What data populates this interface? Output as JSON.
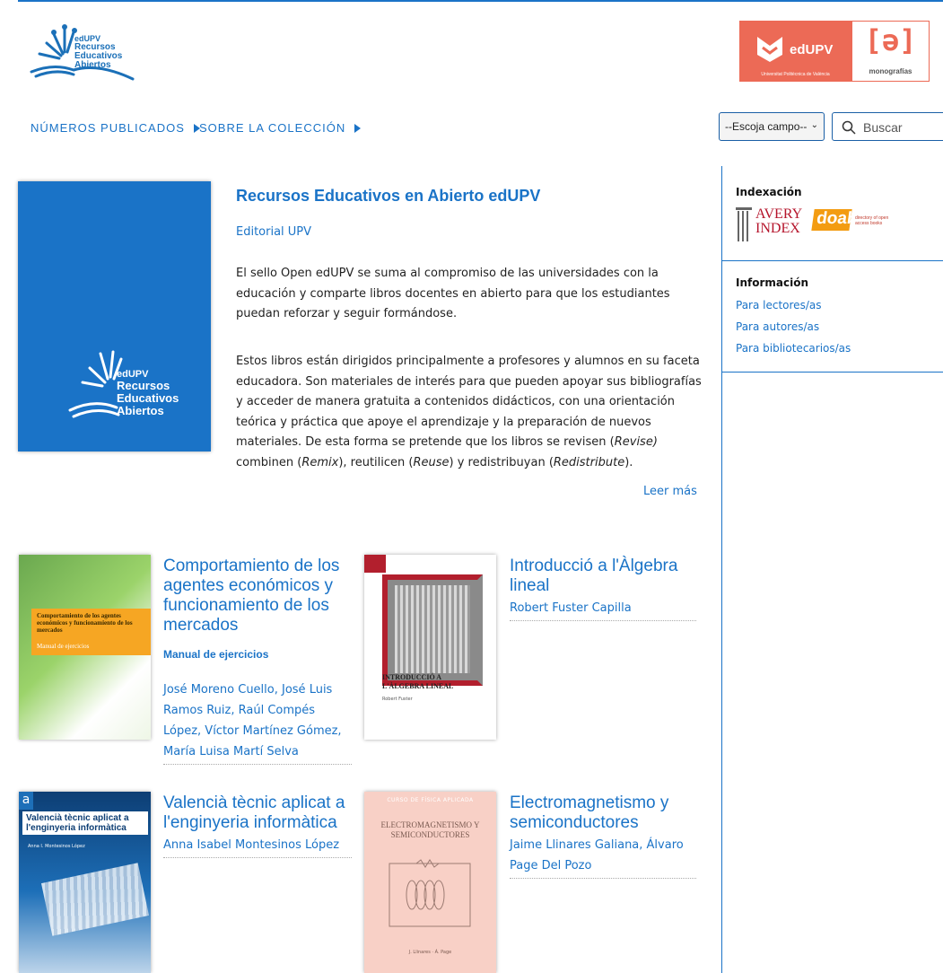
{
  "header": {
    "logo_text_1": "edUPV",
    "logo_text_2": "Recursos",
    "logo_text_3": "Educativos",
    "logo_text_4": "Abiertos",
    "edupv_brand": "edUPV",
    "edupv_sub": "Universitat Politècnica de València",
    "mono_glyph": "[ə]",
    "mono_label": "monografías"
  },
  "nav": {
    "item1": "NÚMEROS PUBLICADOS",
    "item2": "SOBRE LA COLECCIÓN",
    "select_value": "--Escoja campo--",
    "search_placeholder": "Buscar"
  },
  "sidebar": {
    "indexacion_title": "Indexación",
    "avery_1": "AVERY",
    "avery_2": "INDEX",
    "doab": "doab",
    "doab_sub": "directory of open access books",
    "informacion_title": "Información",
    "links": [
      "Para lectores/as",
      "Para autores/as",
      "Para bibliotecarios/as"
    ]
  },
  "featured": {
    "title": "Recursos Educativos en Abierto edUPV",
    "publisher": "Editorial UPV",
    "p1": "El sello Open edUPV se suma al compromiso de las universidades con la educación y comparte libros docentes en abierto para que los estudiantes puedan reforzar y seguir formándose.",
    "p2_a": "Estos libros están dirigidos principalmente a profesores y alumnos en su faceta educadora. Son materiales de interés para que pueden apoyar sus bibliografías y acceder de manera gratuita a contenidos didácticos, con una orientación teórica y práctica que apoye el aprendizaje y la preparación de nuevos materiales. De esta forma se pretende que los libros se revisen (",
    "revise": "Revise)",
    "p2_b": " combinen (",
    "remix": "Remix",
    "p2_c": "), reutilicen (",
    "reuse": "Reuse",
    "p2_d": ") y redistribuyan (",
    "redistribute": "Redistribute",
    "p2_e": ").",
    "read_more": "Leer más",
    "cover_1": "edUPV",
    "cover_2": "Recursos",
    "cover_3": "Educativos",
    "cover_4": "Abiertos"
  },
  "books": [
    {
      "title": "Comportamiento de los agentes económicos y funcionamiento de los mercados",
      "subtitle": "Manual de ejercicios",
      "authors": "José Moreno Cuello, José Luis Ramos Ruiz, Raúl Compés López, Víctor Martínez Gómez, María Luisa Martí Selva",
      "cover_title": "Comportamiento de los agentes económicos y funcionamiento de los mercados",
      "cover_sub": "Manual de ejercicios"
    },
    {
      "title": "Introducció a l'Àlgebra lineal",
      "authors": "Robert Fuster Capilla",
      "cover_title": "INTRODUCCIÓ A L'ÀLGEBRA LINEAL",
      "cover_author": "Robert Fuster"
    },
    {
      "title": "Valencià tècnic aplicat a l'enginyeria informàtica",
      "authors": "Anna Isabel Montesinos López",
      "cover_title": "Valencià tècnic aplicat a l'enginyeria informàtica",
      "cover_author": "Anna I. Montesinos López"
    },
    {
      "title": "Electromagnetismo y semiconductores",
      "authors": "Jaime Llinares Galiana, Álvaro Page Del Pozo",
      "cover_series": "CURSO DE FÍSICA APLICADA",
      "cover_title": "ELECTROMAGNETISMO Y SEMICONDUCTORES",
      "cover_author": "J. Llinares · Á. Page"
    }
  ]
}
